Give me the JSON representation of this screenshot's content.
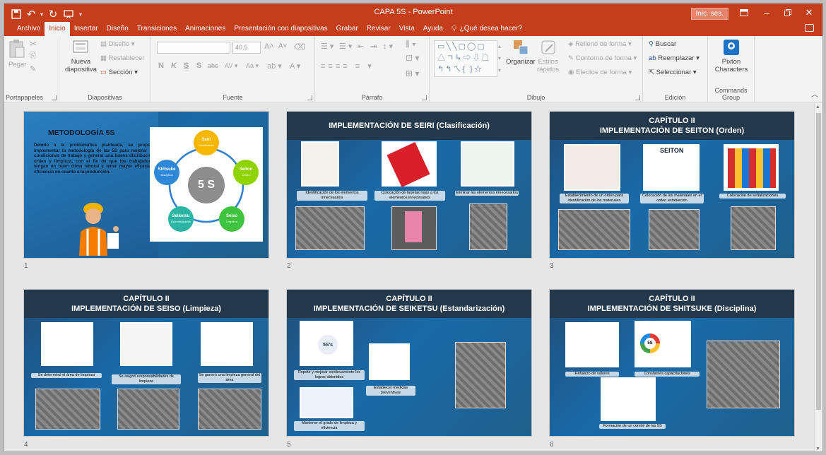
{
  "window": {
    "title": "CAPA 5S  -  PowerPoint",
    "signin_label": "Inic. ses.",
    "colors": {
      "accent": "#c43e1c",
      "slide_header": "#243a4c",
      "slide_bg": "#1a6aa8"
    }
  },
  "tabs": [
    "Archivo",
    "Inicio",
    "Insertar",
    "Diseño",
    "Transiciones",
    "Animaciones",
    "Presentación con diapositivas",
    "Grabar",
    "Revisar",
    "Vista",
    "Ayuda"
  ],
  "active_tab": "Inicio",
  "tell_me": "¿Qué desea hacer?",
  "ribbon": {
    "portapapeles": {
      "label": "Portapapeles",
      "paste": "Pegar"
    },
    "diapositivas": {
      "label": "Diapositivas",
      "new_slide_1": "Nueva",
      "new_slide_2": "diapositiva",
      "layout": "Diseño",
      "reset": "Restablecer",
      "section": "Sección"
    },
    "fuente": {
      "label": "Fuente",
      "size": "40,5",
      "bold": "N",
      "italic": "K",
      "underline": "S",
      "shadow": "S",
      "strike": "abc",
      "spacing": "AV",
      "case": "Aa"
    },
    "parrafo": {
      "label": "Párrafo"
    },
    "dibujo": {
      "label": "Dibujo",
      "organize": "Organizar",
      "styles_1": "Estilos",
      "styles_2": "rápidos",
      "fill": "Relleno de forma",
      "outline": "Contorno de forma",
      "effects": "Efectos de forma"
    },
    "edicion": {
      "label": "Edición",
      "find": "Buscar",
      "replace": "Reemplazar",
      "select": "Seleccionar"
    },
    "commands": {
      "label": "Commands Group",
      "pixton_1": "Pixton",
      "pixton_2": "Characters"
    }
  },
  "slides": [
    {
      "num": "1",
      "title": "METODOLOGÍA 5S",
      "body": "Debido a la problemática planteada, se propone implementar la metodología de las 5S para mejorar las condiciones de trabajo y generar una buena distribución, orden y limpieza, con el fin de que los trabajadores tengan un buen clima laboral y tener mayor eficacia y eficiencia en cuanto a la producción.",
      "center": "5 S",
      "nodes": [
        {
          "name": "Seiri",
          "sub": "Clasificación"
        },
        {
          "name": "Seiton",
          "sub": "Orden"
        },
        {
          "name": "Seiso",
          "sub": "Limpieza"
        },
        {
          "name": "Seiketsu",
          "sub": "Estandarización"
        },
        {
          "name": "Shitsuke",
          "sub": "Disciplina"
        }
      ]
    },
    {
      "num": "2",
      "line1": "IMPLEMENTACIÓN DE SEIRI (Clasificación)",
      "captions": [
        "Identificación de los elementos innecesarios",
        "Colocación de tarjetas rojas a los elementos innecesarios",
        "Eliminar los elementos innecesarios"
      ]
    },
    {
      "num": "3",
      "line0": "CAPÍTULO II",
      "line1": "IMPLEMENTACIÓN DE SEITON (Orden)",
      "sign": "SEITON",
      "captions": [
        "Establecimiento de un orden para identificación de los materiales",
        "Colocación de los materiales en el orden establecido",
        "Colocación de señalizaciones"
      ]
    },
    {
      "num": "4",
      "line0": "CAPÍTULO II",
      "line1": "IMPLEMENTACIÓN DE SEISO (Limpieza)",
      "captions": [
        "Se determinó el área de limpieza",
        "Se asignó responsabilidades de limpieza",
        "Se generó una limpieza general del área"
      ]
    },
    {
      "num": "5",
      "line0": "CAPÍTULO II",
      "line1": "IMPLEMENTACIÓN DE SEIKETSU (Estandarización)",
      "hex": "5S's",
      "captions": [
        "Repetir y mejorar continuamente los logros obtenidos",
        "Establecer medidas preventivas",
        "Mantener el grado de limpieza y eficiencia"
      ]
    },
    {
      "num": "6",
      "line0": "CAPÍTULO II",
      "line1": "IMPLEMENTACIÓN DE SHITSUKE (Disciplina)",
      "badge": "5S",
      "captions": [
        "Refuerzo de valores",
        "Constantes capacitaciones",
        "Formación de un comité de las 5S"
      ]
    }
  ]
}
